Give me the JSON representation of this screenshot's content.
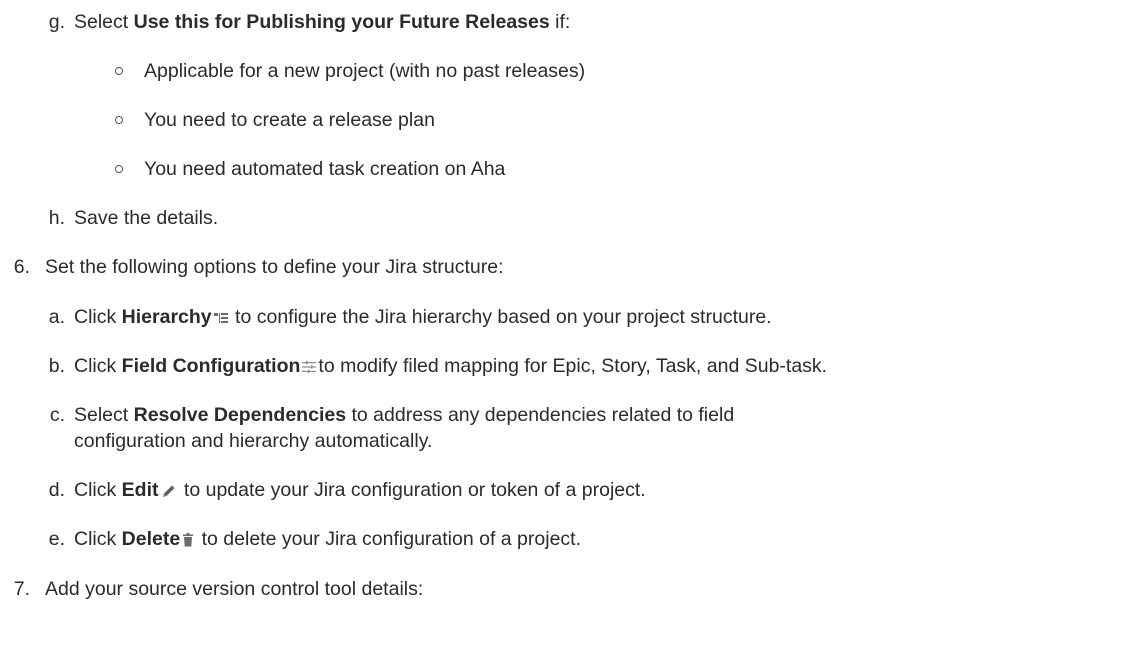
{
  "items": {
    "g": {
      "marker": "g.",
      "pre": "Select ",
      "bold": "Use this for Publishing your Future Releases",
      "post": " if:"
    },
    "g_bullets": [
      "Applicable for a new project (with no past releases)",
      "You need to create a release plan",
      "You need automated task creation on Aha"
    ],
    "h": {
      "marker": "h.",
      "text": "Save the details."
    },
    "six": {
      "marker": "6.",
      "text": "Set the following options to define your Jira structure:"
    },
    "six_a": {
      "marker": "a.",
      "pre": "Click ",
      "bold": "Hierarchy",
      "post": " to configure the Jira hierarchy based on your project structure.",
      "icon": "hierarchy-icon"
    },
    "six_b": {
      "marker": "b.",
      "pre": "Click ",
      "bold": "Field Configuration",
      "post": "to modify filed mapping for Epic, Story, Task, and Sub-task.",
      "icon": "field-configuration-icon"
    },
    "six_c": {
      "marker": "c.",
      "pre": "Select ",
      "bold": "Resolve Dependencies",
      "post": " to address any dependencies related to field",
      "line2": "configuration and hierarchy automatically."
    },
    "six_d": {
      "marker": "d.",
      "pre": "Click ",
      "bold": "Edit",
      "post": " to update your Jira configuration or token of a project.",
      "icon": "pencil-icon"
    },
    "six_e": {
      "marker": "e.",
      "pre": "Click ",
      "bold": "Delete",
      "post": " to delete your Jira configuration of a project.",
      "icon": "trash-icon"
    },
    "seven": {
      "marker": "7.",
      "text": "Add your source version control tool details:"
    }
  },
  "colors": {
    "text": "#2b2b2b",
    "icon": "#6b6b6b"
  }
}
